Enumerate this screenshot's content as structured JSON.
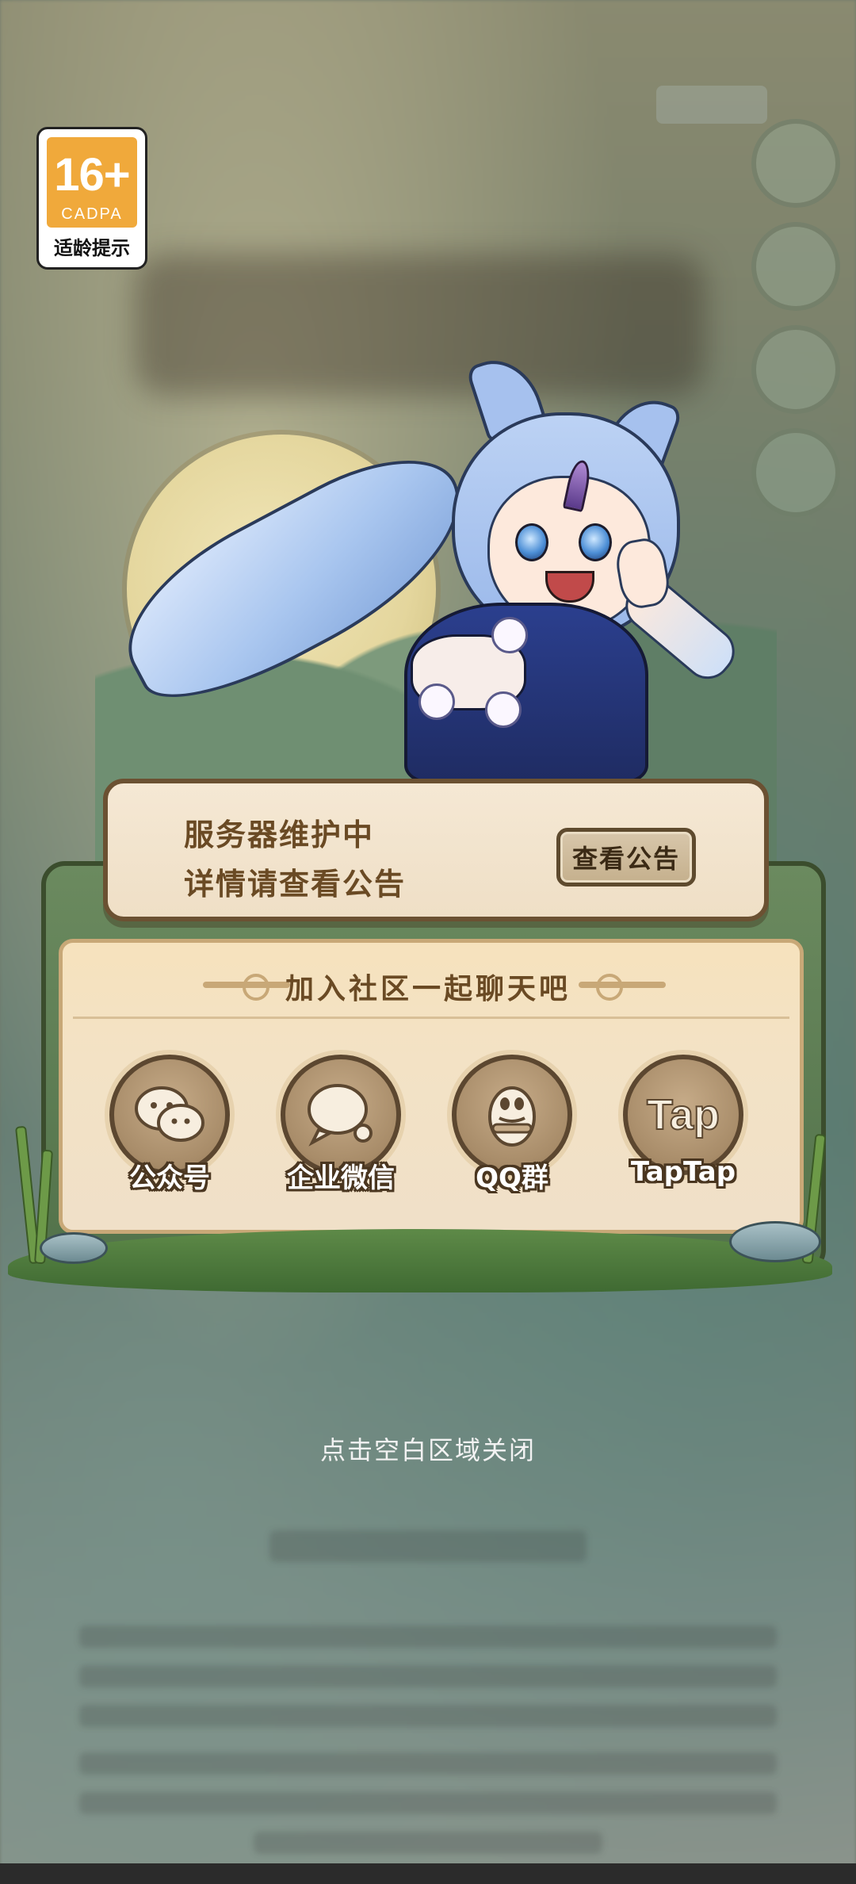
{
  "age_rating": {
    "age": "16+",
    "org": "CADPA",
    "hint": "适龄提示"
  },
  "notice": {
    "line1": "服务器维护中",
    "line2": "详情请查看公告",
    "button": "查看公告"
  },
  "community": {
    "title": "加入社区一起聊天吧",
    "items": [
      {
        "label": "公众号",
        "icon": "wechat-icon"
      },
      {
        "label": "企业微信",
        "icon": "wecom-icon"
      },
      {
        "label": "QQ群",
        "icon": "qq-icon"
      },
      {
        "label": "TapTap",
        "icon": "taptap-icon",
        "glyph": "Tap"
      }
    ]
  },
  "close_hint": "点击空白区域关闭",
  "colors": {
    "card_bg": "#f5e8d4",
    "text_brown": "#6a4a24",
    "panel_green": "#52724a",
    "badge_orange": "#f0a93b"
  }
}
